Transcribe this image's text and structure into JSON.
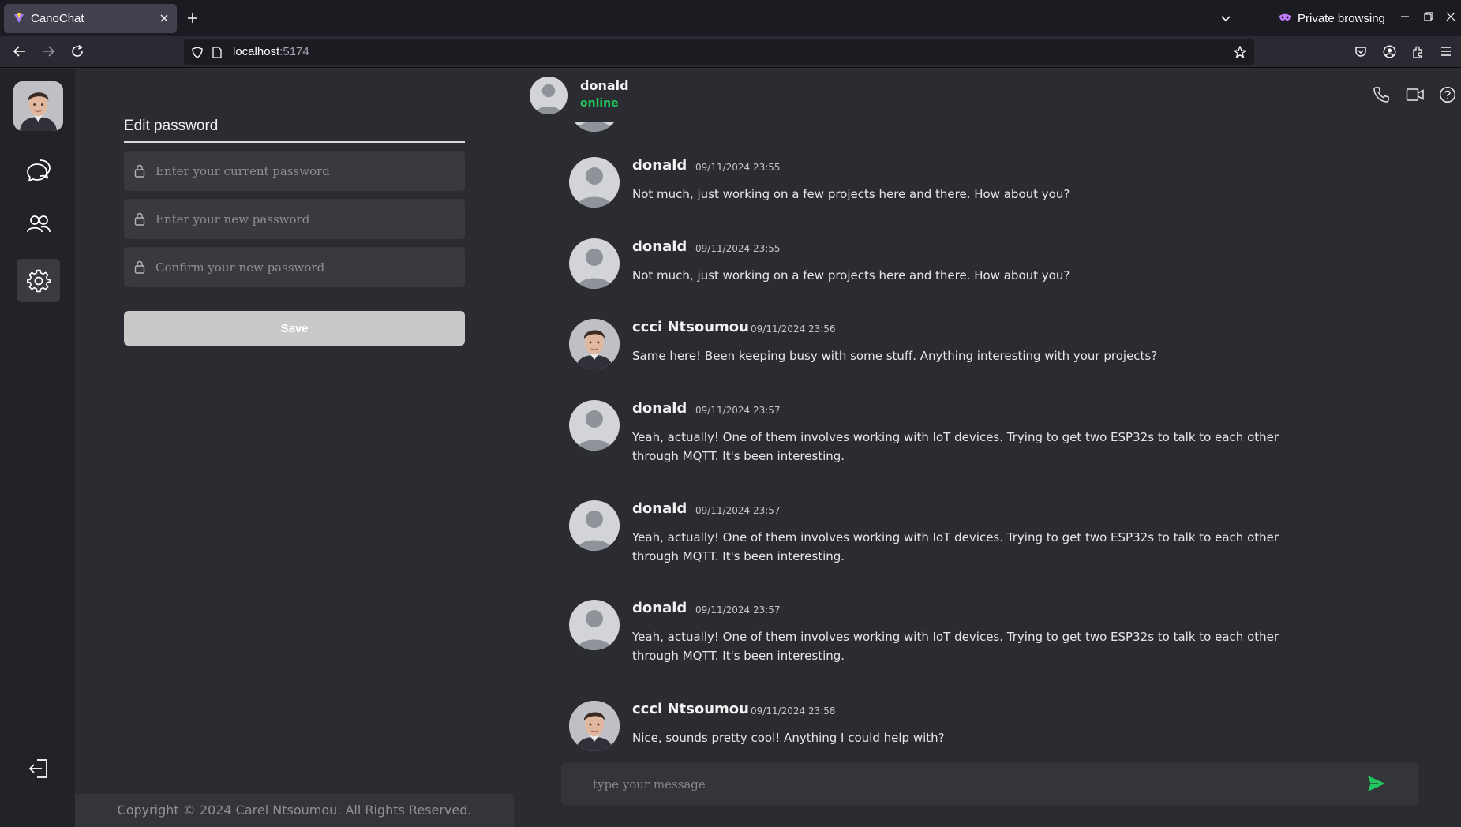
{
  "browser": {
    "tab_title": "CanoChat",
    "private_label": "Private browsing",
    "url_host": "localhost",
    "url_port": ":5174"
  },
  "sidebar": {
    "items": [
      {
        "name": "chats",
        "icon": "chat-bubbles-icon"
      },
      {
        "name": "contacts",
        "icon": "users-icon"
      },
      {
        "name": "settings",
        "icon": "gear-icon",
        "active": true
      }
    ],
    "logout_icon": "logout-icon"
  },
  "settings": {
    "title": "Edit password",
    "current_placeholder": "Enter your current password",
    "new_placeholder": "Enter your new password",
    "confirm_placeholder": "Confirm your new password",
    "save_label": "Save",
    "copyright": "Copyright © 2024 Carel Ntsoumou. All Rights Reserved."
  },
  "chat": {
    "contact_name": "donald",
    "contact_status": "online",
    "messages": [
      {
        "author": "donald",
        "time": "09/11/2024 23:55",
        "text": "Not much, just working on a few projects here and there. How about you?"
      },
      {
        "author": "donald",
        "time": "09/11/2024 23:55",
        "text": "Not much, just working on a few projects here and there. How about you?"
      },
      {
        "author": "ccci Ntsoumou",
        "time": "09/11/2024 23:56",
        "text": "Same here! Been keeping busy with some stuff. Anything interesting with your projects?"
      },
      {
        "author": "donald",
        "time": "09/11/2024 23:57",
        "text": "Yeah, actually! One of them involves working with IoT devices. Trying to get two ESP32s to talk to each other through MQTT. It's been interesting."
      },
      {
        "author": "donald",
        "time": "09/11/2024 23:57",
        "text": "Yeah, actually! One of them involves working with IoT devices. Trying to get two ESP32s to talk to each other through MQTT. It's been interesting."
      },
      {
        "author": "donald",
        "time": "09/11/2024 23:57",
        "text": "Yeah, actually! One of them involves working with IoT devices. Trying to get two ESP32s to talk to each other through MQTT. It's been interesting."
      },
      {
        "author": "ccci Ntsoumou",
        "time": "09/11/2024 23:58",
        "text": "Nice, sounds pretty cool! Anything I could help with?"
      }
    ],
    "composer_placeholder": "type your message"
  },
  "colors": {
    "accent_online": "#22c55e",
    "send": "#22c55e"
  }
}
